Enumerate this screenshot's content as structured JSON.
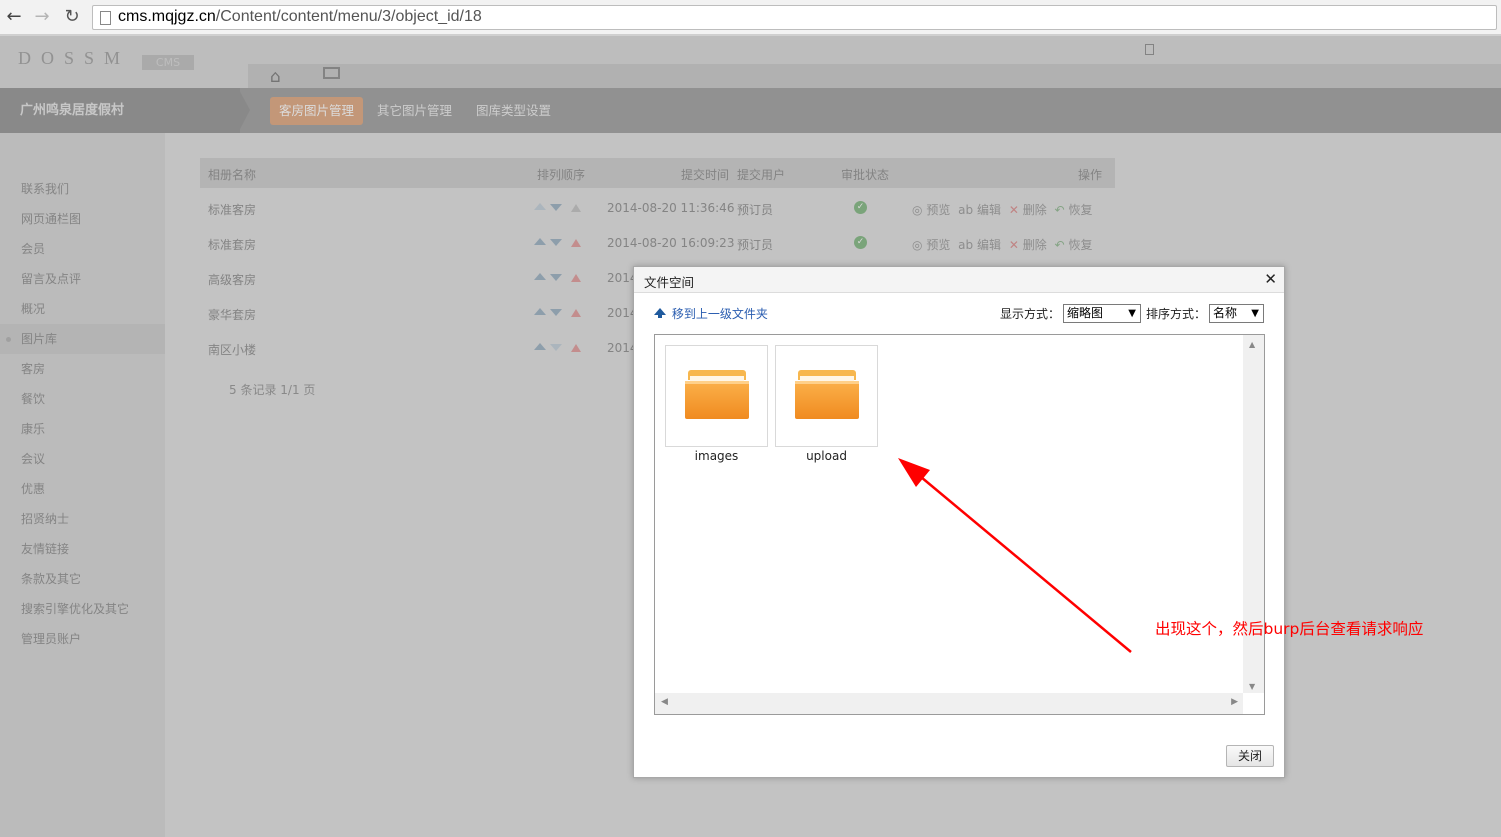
{
  "browser": {
    "url_host": "cms.mqjgz.cn",
    "url_path": "/Content/content/menu/3/object_id/18"
  },
  "cms": {
    "logo": "DOSSM",
    "badge": "CMS",
    "site_name": "广州鸣泉居度假村",
    "subtabs": [
      "客房图片管理",
      "其它图片管理",
      "图库类型设置"
    ],
    "sidebar": [
      "联系我们",
      "网页通栏图",
      "会员",
      "留言及点评",
      "概况",
      "图片库",
      "客房",
      "餐饮",
      "康乐",
      "会议",
      "优惠",
      "招贤纳士",
      "友情链接",
      "条款及其它",
      "搜索引擎优化及其它",
      "管理员账户"
    ],
    "table": {
      "headers": {
        "name": "相册名称",
        "order": "排列顺序",
        "time": "提交时间",
        "user": "提交用户",
        "status": "审批状态",
        "ops": "操作"
      },
      "rows": [
        {
          "name": "标准客房",
          "time": "2014-08-20 11:36:46",
          "user": "预订员"
        },
        {
          "name": "标准套房",
          "time": "2014-08-20 16:09:23",
          "user": "预订员"
        },
        {
          "name": "高级客房",
          "time": "2014"
        },
        {
          "name": "豪华套房",
          "time": "2014"
        },
        {
          "name": "南区小楼",
          "time": "2014"
        }
      ],
      "op_labels": {
        "preview": "预览",
        "edit": "编辑",
        "delete": "删除",
        "restore": "恢复"
      }
    },
    "pager": "5 条记录 1/1 页"
  },
  "dialog": {
    "title": "文件空间",
    "up_link": "移到上一级文件夹",
    "view_label": "显示方式：",
    "view_value": "缩略图",
    "sort_label": "排序方式：",
    "sort_value": "名称",
    "folders": [
      {
        "name": "images"
      },
      {
        "name": "upload"
      }
    ],
    "close_button": "关闭"
  },
  "annotation": {
    "text": "出现这个，然后burp后台查看请求响应",
    "color": "#ff0000"
  }
}
